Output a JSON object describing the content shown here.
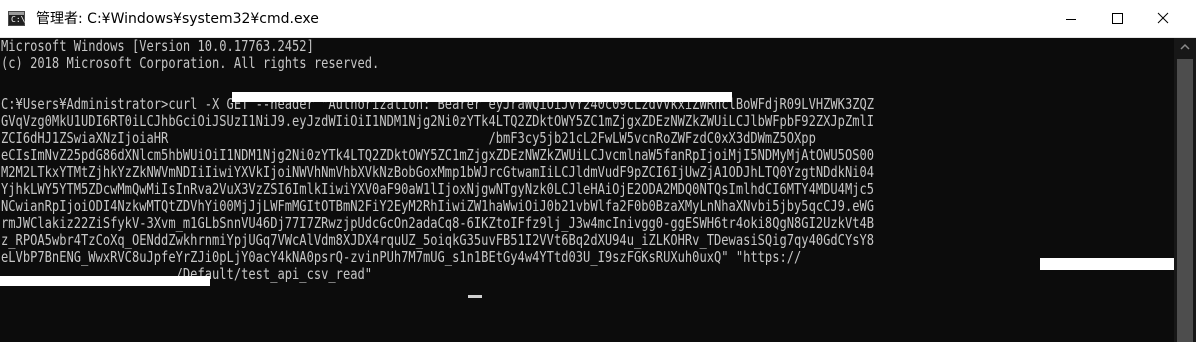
{
  "window": {
    "title": "管理者: C:¥Windows¥system32¥cmd.exe",
    "icon_glyph": "C:\\",
    "icon": "cmd-icon"
  },
  "controls": {
    "minimize": "minimize-icon",
    "maximize": "maximize-icon",
    "close": "close-icon"
  },
  "console": {
    "lines": [
      "Microsoft Windows [Version 10.0.17763.2452]",
      "(c) 2018 Microsoft Corporation. All rights reserved.",
      "",
      "C:¥Users¥Administrator>curl -X GET --header \"Authorization: Bearer eyJraWQiOiJvY240c09cLzdvVkxiZWRhclBoWFdjR09LVHZWK3ZQZ",
      "GVqVzg0MkU1UDI6RT0iLCJhbGciOiJSUzI1NiJ9.eyJzdWIiOiI1NDM1Njg2Ni0zYTk4LTQ2ZDktOWY5ZC1mZjgxZDEzNWZkZWUiLCJlbWFpbF92ZXJpZmlI",
      "ZCI6dHJ1ZSwiaXNzIjoiaHR                                            /bmF3cy5jb21cL2FwLW5vcnRoZWFzdC0xX3dDWmZ5OXpp",
      "eCIsImNvZ25pdG86dXNlcm5hbWUiOiI1NDM1Njg2Ni0zYTk4LTQ2ZDktOWY5ZC1mZjgxZDEzNWZkZWUiLCJvcmlnaW5fanRpIjoiMjI5NDMyMjAtOWU5OS00",
      "M2M2LTkxYTMtZjhkYzZkNWVmNDIiIiwiYXVkIjoiNWVhNmVhbXVkNzBobGoxMmp1bWJrcGtwamIiLCJldmVudF9pZCI6IjUwZjA1ODJhLTQ0YzgtNDdkNi04",
      "YjhkLWY5YTM5ZDcwMmQwMiIsInRva2VuX3VzZSI6ImlkIiwiYXV0aF90aW1lIjoxNjgwNTgyNzk0LCJleHAiOjE2ODA2MDQ0NTQsImlhdCI6MTY4MDU4Mjc5",
      "NCwianRpIjoiODI4NzkwMTQtZDVhYi00MjJjLWFmMGItOTBmN2FiY2EyM2RhIiwiZW1haWwiOiJ0b21vbWlfa2F0b0BzaXMyLnNhaXNvbi5jby5qcCJ9.eWG",
      "rmJWClakiz22ZiSfykV-3Xvm_m1GLbSnnVU46Dj77I7ZRwzjpUdcGcOn2adaCq8-6IKZtoIFfz9lj_J3w4mcInivgg0-ggESWH6tr4oki8QgN8GI2UzkVt4B",
      "z_RPOA5wbr4TzCoXq_OENddZwkhrnmiYpjUGq7VWcAlVdm8XJDX4rquUZ_5oiqkG35uvFB51I2VVt6Bq2dXU94u_iZLKOHRv_TDewasiSQig7qy40GdCYsY8",
      "eLVbP7BnENG_WwxRVC8uJpfeYrZJi0pLjY0acY4kNA0psrQ-zvinPUh7M7mUG_s1n1BEtGy4w4YTtd03U_I9szFGKsRUXuh0uxQ\" \"https://",
      "                        /Default/test_api_csv_read\""
    ]
  },
  "scrollbar": {
    "up_arrow": "scroll-up-arrow-icon"
  }
}
